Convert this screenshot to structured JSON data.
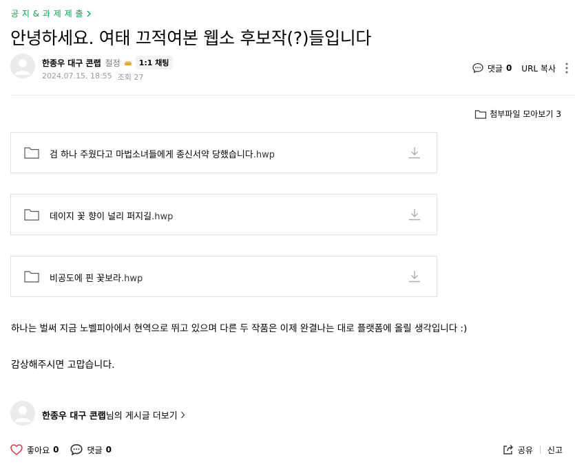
{
  "breadcrumb": {
    "label": "공 지 & 과 제 제 출"
  },
  "post": {
    "title": "안녕하세요. 여태 끄적여본 웹소 후보작(?)들입니다",
    "author": {
      "name": "한종우 대구 콘랩",
      "grade": "절정",
      "chat_label": "1:1 채팅"
    },
    "meta": {
      "date": "2024.07.15. 18:55",
      "views": "조회 27"
    }
  },
  "top_actions": {
    "comment_label": "댓글",
    "comment_count": "0",
    "url_copy": "URL 복사"
  },
  "attachments": {
    "toggle_label": "첨부파일 모아보기",
    "count": "3",
    "files": [
      {
        "name": "검 하나 주웠다고 마법소녀들에게 종신서약 당했습니다",
        "ext": ".hwp"
      },
      {
        "name": "데이지 꽃 향이 널리 퍼지길",
        "ext": ".hwp"
      },
      {
        "name": "비공도에 핀 꽃보라",
        "ext": ".hwp"
      }
    ]
  },
  "content": {
    "paragraph1": "하나는 벌써 지금 노벨피아에서 현역으로 뛰고 있으며 다른 두 작품은 이제 완결나는 대로 플랫폼에 올릴 생각입니다 :)",
    "paragraph2": "감상해주시면 고맙습니다."
  },
  "more_posts": {
    "author": "한종우 대구 콘랩",
    "suffix": "님의 게시글 더보기"
  },
  "bottom_bar": {
    "like_label": "좋아요",
    "like_count": "0",
    "comment_label": "댓글",
    "comment_count": "0",
    "share_label": "공유",
    "report_label": "신고"
  },
  "colors": {
    "accent": "#03a94f",
    "like": "#e0323c",
    "border": "#e1e1e1"
  }
}
